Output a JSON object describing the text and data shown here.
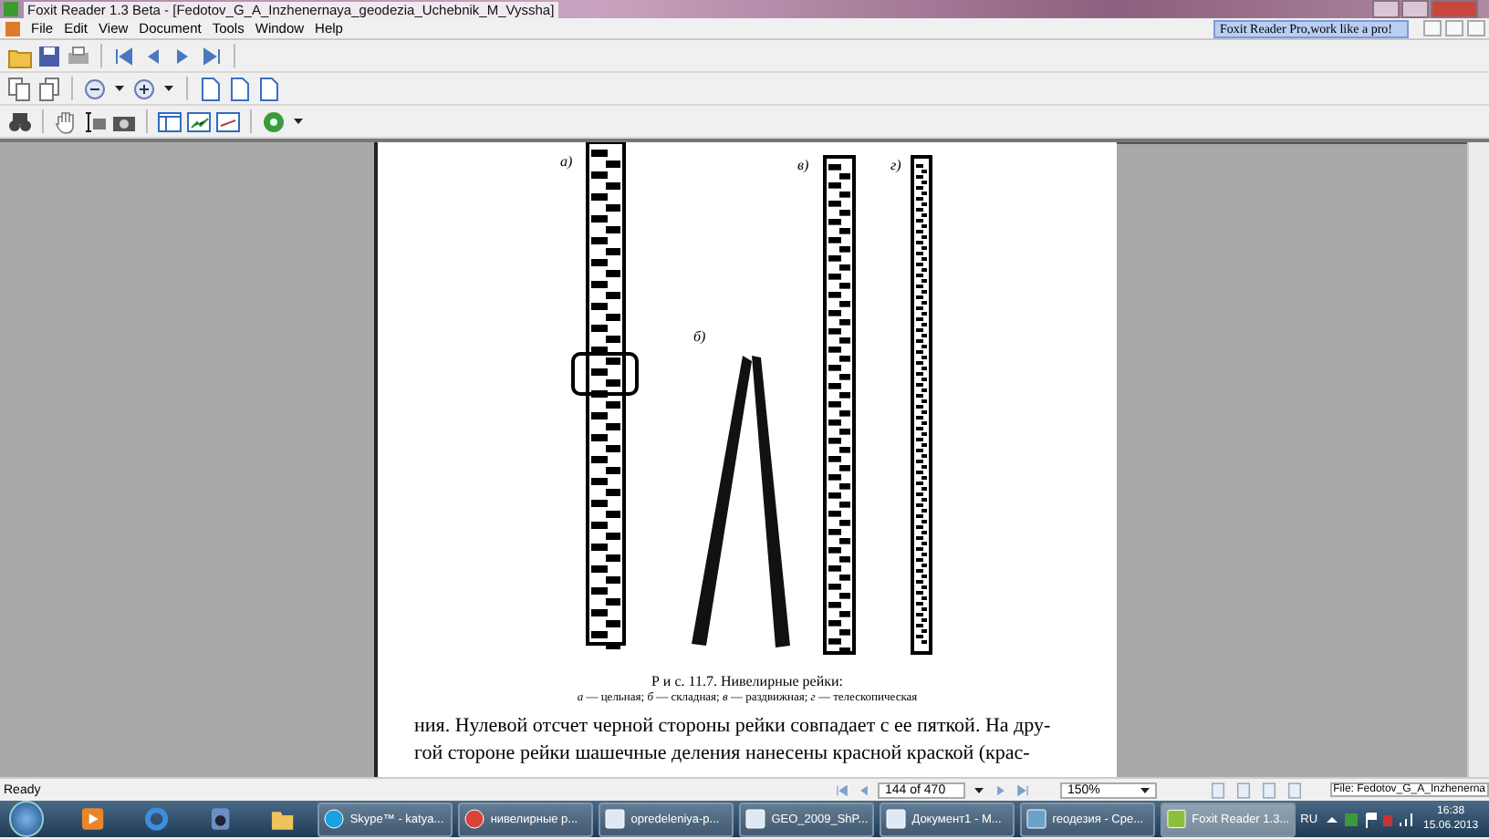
{
  "window": {
    "title": "Foxit Reader 1.3 Beta - [Fedotov_G_A_Inzhenernaya_geodezia_Uchebnik_M_Vyssha]"
  },
  "menu": [
    "File",
    "Edit",
    "View",
    "Document",
    "Tools",
    "Window",
    "Help"
  ],
  "ad_banner": "Foxit Reader Pro,work like a pro!",
  "document": {
    "figure_labels": [
      "а)",
      "б)",
      "в)",
      "г)"
    ],
    "caption": "Р и с. 11.7.  Нивелирные  рейки:",
    "legend": "*а* — цельная; *б* — складная; *в* — раздвижная; *г* — телескопическая",
    "body_lines": [
      "ния. Нулевой отсчет черной стороны рейки совпадает с ее пяткой. На дру-",
      "гой стороне рейки шашечные деления нанесены красной краской (крас-"
    ]
  },
  "status_bar": {
    "status": "Ready",
    "page": "144 of 470",
    "zoom": "150%",
    "file": "File: Fedotov_G_A_Inzhenerna"
  },
  "taskbar": {
    "tasks": [
      {
        "label": "Skype™ - katya...",
        "kind": "skype",
        "selected": false
      },
      {
        "label": "нивелирные р...",
        "kind": "chrome",
        "selected": false
      },
      {
        "label": "opredeleniya-p...",
        "kind": "word",
        "selected": false
      },
      {
        "label": "GEO_2009_ShP...",
        "kind": "word",
        "selected": false
      },
      {
        "label": "Документ1 - M...",
        "kind": "word",
        "selected": false
      },
      {
        "label": "геодезия - Сре...",
        "kind": "photo",
        "selected": false
      },
      {
        "label": "Foxit Reader 1.3...",
        "kind": "foxit",
        "selected": true
      }
    ],
    "language": "RU",
    "time": "16:38",
    "date": "15.06.2013"
  }
}
